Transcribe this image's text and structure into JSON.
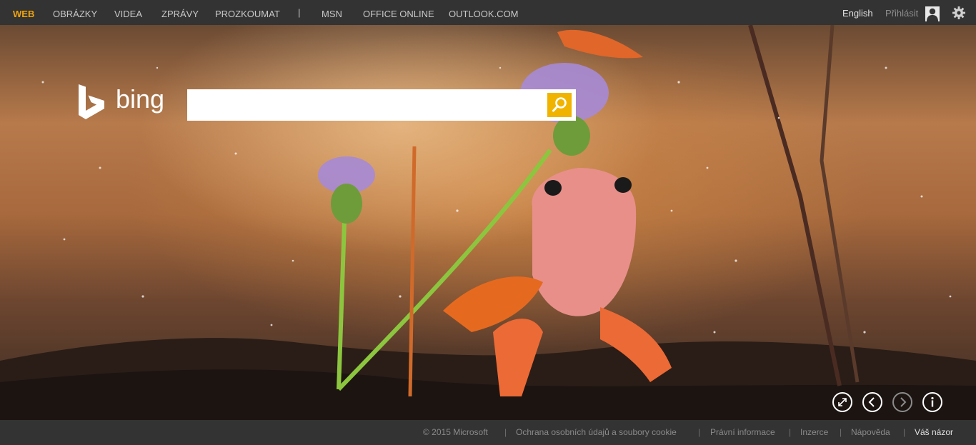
{
  "nav": {
    "items": [
      {
        "label": "WEB"
      },
      {
        "label": "OBRÁZKY"
      },
      {
        "label": "VIDEA"
      },
      {
        "label": "ZPRÁVY"
      },
      {
        "label": "PROZKOUMAT"
      },
      {
        "label": "|"
      },
      {
        "label": "MSN"
      },
      {
        "label": "OFFICE ONLINE"
      },
      {
        "label": "OUTLOOK.COM"
      }
    ],
    "active": "WEB",
    "accent_color": "#f0a30a"
  },
  "account": {
    "language": "English",
    "sign_in": "Přihlásit",
    "avatar_icon": "user-icon",
    "settings_icon": "gear-icon"
  },
  "logo": {
    "wordmark": "bing",
    "icon": "bing-b-icon"
  },
  "search": {
    "value": "",
    "placeholder": "",
    "button_icon": "search-icon",
    "button_color": "#f0b400"
  },
  "hero_controls": [
    {
      "icon": "fullscreen-icon",
      "enabled": true
    },
    {
      "icon": "chevron-left-icon",
      "enabled": true
    },
    {
      "icon": "chevron-right-icon",
      "enabled": false
    },
    {
      "icon": "info-icon",
      "enabled": true
    }
  ],
  "footer": {
    "copyright": "© 2015 Microsoft",
    "links": [
      {
        "label": "Ochrana osobních údajů a soubory cookie"
      },
      {
        "label": "Právní informace"
      },
      {
        "label": "Inzerce"
      },
      {
        "label": "Nápověda"
      },
      {
        "label": "Váš názor"
      }
    ],
    "separator": "|"
  }
}
